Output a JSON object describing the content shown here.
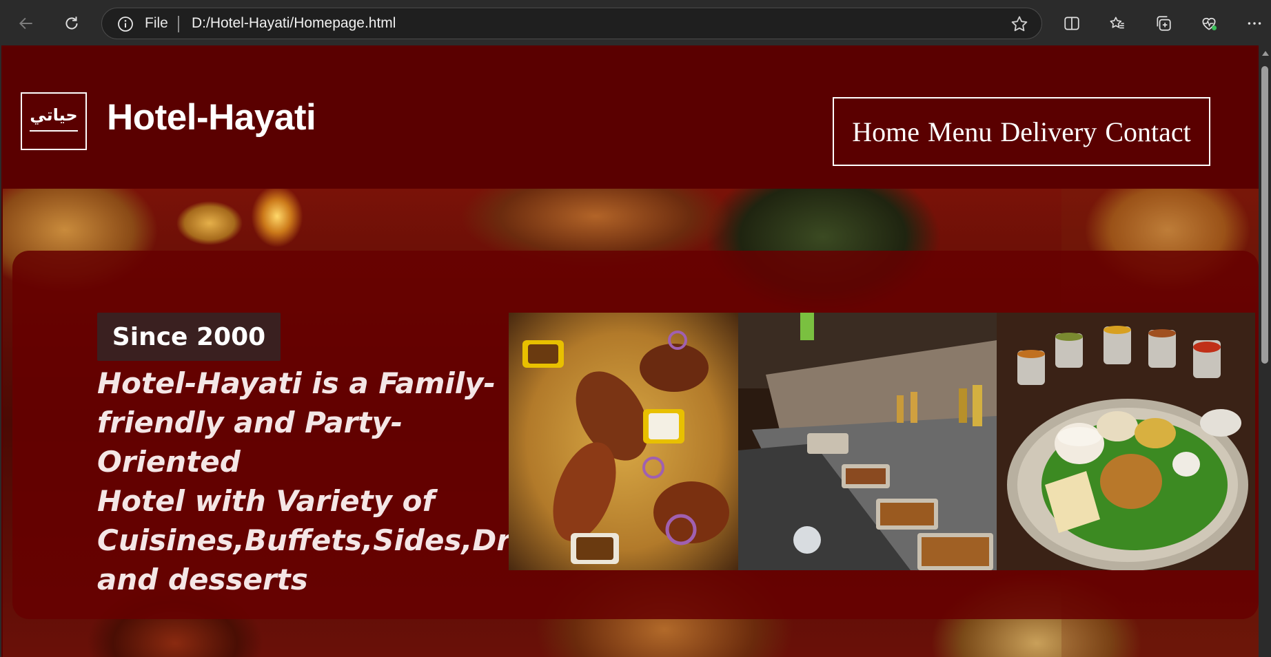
{
  "browser": {
    "scheme_label": "File",
    "url": "D:/Hotel-Hayati/Homepage.html"
  },
  "header": {
    "logo_text": "حياتي",
    "title": "Hotel-Hayati",
    "nav": [
      "Home",
      "Menu",
      "Delivery",
      "Contact"
    ]
  },
  "hero": {
    "badge": "Since 2000",
    "tagline": "Hotel-Hayati is a Family-\nfriendly and Party-Oriented\nHotel with Variety of\nCuisines,Buffets,Sides,Drinks\nand desserts"
  },
  "icons": {
    "back": "back-arrow-icon",
    "reload": "reload-icon",
    "info": "info-icon",
    "favorite": "star-outline-icon",
    "split": "split-screen-icon",
    "favorites": "favorites-icon",
    "collections": "collections-icon",
    "performance": "browser-essentials-icon",
    "more": "more-icon"
  },
  "colors": {
    "page_bg": "#5a0000",
    "card_bg": "#660000",
    "badge_bg": "#3a2020",
    "text": "#ffffff"
  }
}
